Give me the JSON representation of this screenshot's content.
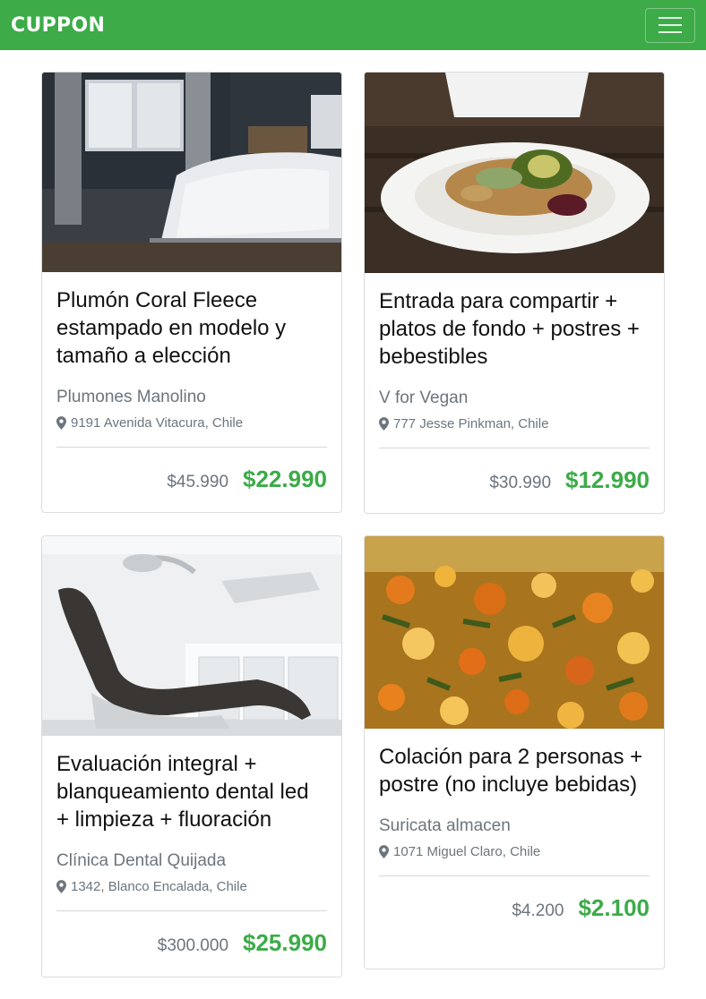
{
  "navbar": {
    "brand": "CUPPON"
  },
  "cards": [
    {
      "title": "Plumón Coral Fleece estampado en modelo y tamaño a elección",
      "vendor": "Plumones Manolino",
      "address": "9191 Avenida Vitacura, Chile",
      "old_price": "$45.990",
      "new_price": "$22.990"
    },
    {
      "title": "Entrada para compartir + platos de fondo + postres + bebestibles",
      "vendor": "V for Vegan",
      "address": "777 Jesse Pinkman, Chile",
      "old_price": "$30.990",
      "new_price": "$12.990"
    },
    {
      "title": "Evaluación integral + blanqueamiento dental led + limpieza + fluoración",
      "vendor": "Clínica Dental Quijada",
      "address": "1342, Blanco Encalada, Chile",
      "old_price": "$300.000",
      "new_price": "$25.990"
    },
    {
      "title": "Colación para 2 personas + postre (no incluye bebidas)",
      "vendor": "Suricata almacen",
      "address": "1071 Miguel Claro, Chile",
      "old_price": "$4.200",
      "new_price": "$2.100"
    }
  ],
  "colors": {
    "brand_green": "#3cab48",
    "muted_text": "#6c757d"
  }
}
